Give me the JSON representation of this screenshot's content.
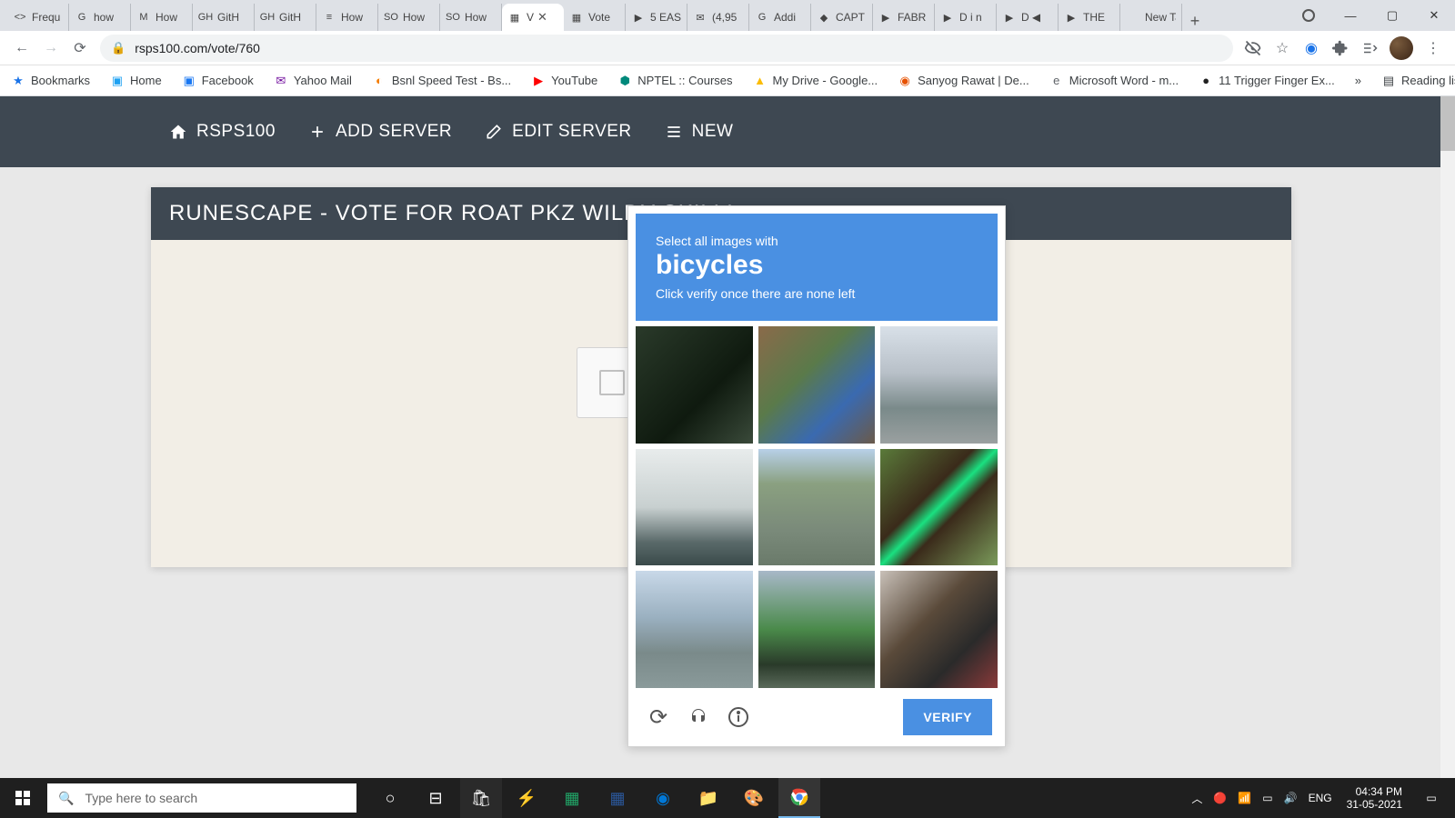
{
  "browser": {
    "tabs": [
      {
        "label": "Frequ",
        "fav": "<>"
      },
      {
        "label": "how",
        "fav": "G"
      },
      {
        "label": "How",
        "fav": "M"
      },
      {
        "label": "GitH",
        "fav": "GH"
      },
      {
        "label": "GitH",
        "fav": "GH"
      },
      {
        "label": "How",
        "fav": "≡"
      },
      {
        "label": "How",
        "fav": "SO"
      },
      {
        "label": "How",
        "fav": "SO"
      },
      {
        "label": "V",
        "fav": "▦",
        "active": true
      },
      {
        "label": "Vote",
        "fav": "▦"
      },
      {
        "label": "5 EAS",
        "fav": "▶"
      },
      {
        "label": "(4,95",
        "fav": "✉"
      },
      {
        "label": "Addi",
        "fav": "G"
      },
      {
        "label": "CAPT",
        "fav": "◆"
      },
      {
        "label": "FABR",
        "fav": "▶"
      },
      {
        "label": "D i n",
        "fav": "▶"
      },
      {
        "label": "D ◀",
        "fav": "▶"
      },
      {
        "label": "THE",
        "fav": "▶"
      },
      {
        "label": "New Tab",
        "fav": ""
      }
    ],
    "url": "rsps100.com/vote/760"
  },
  "bookmarks": [
    {
      "label": "Bookmarks",
      "icon": "★"
    },
    {
      "label": "Home",
      "icon": "tw"
    },
    {
      "label": "Facebook",
      "icon": "fb"
    },
    {
      "label": "Yahoo Mail",
      "icon": "✉"
    },
    {
      "label": "Bsnl Speed Test - Bs...",
      "icon": "◐"
    },
    {
      "label": "YouTube",
      "icon": "▶"
    },
    {
      "label": "NPTEL :: Courses",
      "icon": "⬢"
    },
    {
      "label": "My Drive - Google...",
      "icon": "▲"
    },
    {
      "label": "Sanyog Rawat | De...",
      "icon": "◉"
    },
    {
      "label": "Microsoft Word - m...",
      "icon": "e"
    },
    {
      "label": "11 Trigger Finger Ex...",
      "icon": "●"
    }
  ],
  "bookmark_right": {
    "more": "»",
    "reading": "Reading list"
  },
  "site_nav": [
    {
      "label": "RSPS100",
      "icon": "home"
    },
    {
      "label": "ADD SERVER",
      "icon": "plus"
    },
    {
      "label": "EDIT SERVER",
      "icon": "edit"
    },
    {
      "label": "NEW",
      "icon": "menu"
    }
  ],
  "page": {
    "heading": "RUNESCAPE - VOTE FOR ROAT PKZ WILDY SKILLI"
  },
  "captcha": {
    "line1": "Select all images with",
    "subject": "bicycles",
    "line3": "Click verify once there are none left",
    "verify": "VERIFY"
  },
  "taskbar": {
    "search_placeholder": "Type here to search",
    "lang": "ENG",
    "time": "04:34 PM",
    "date": "31-05-2021"
  }
}
